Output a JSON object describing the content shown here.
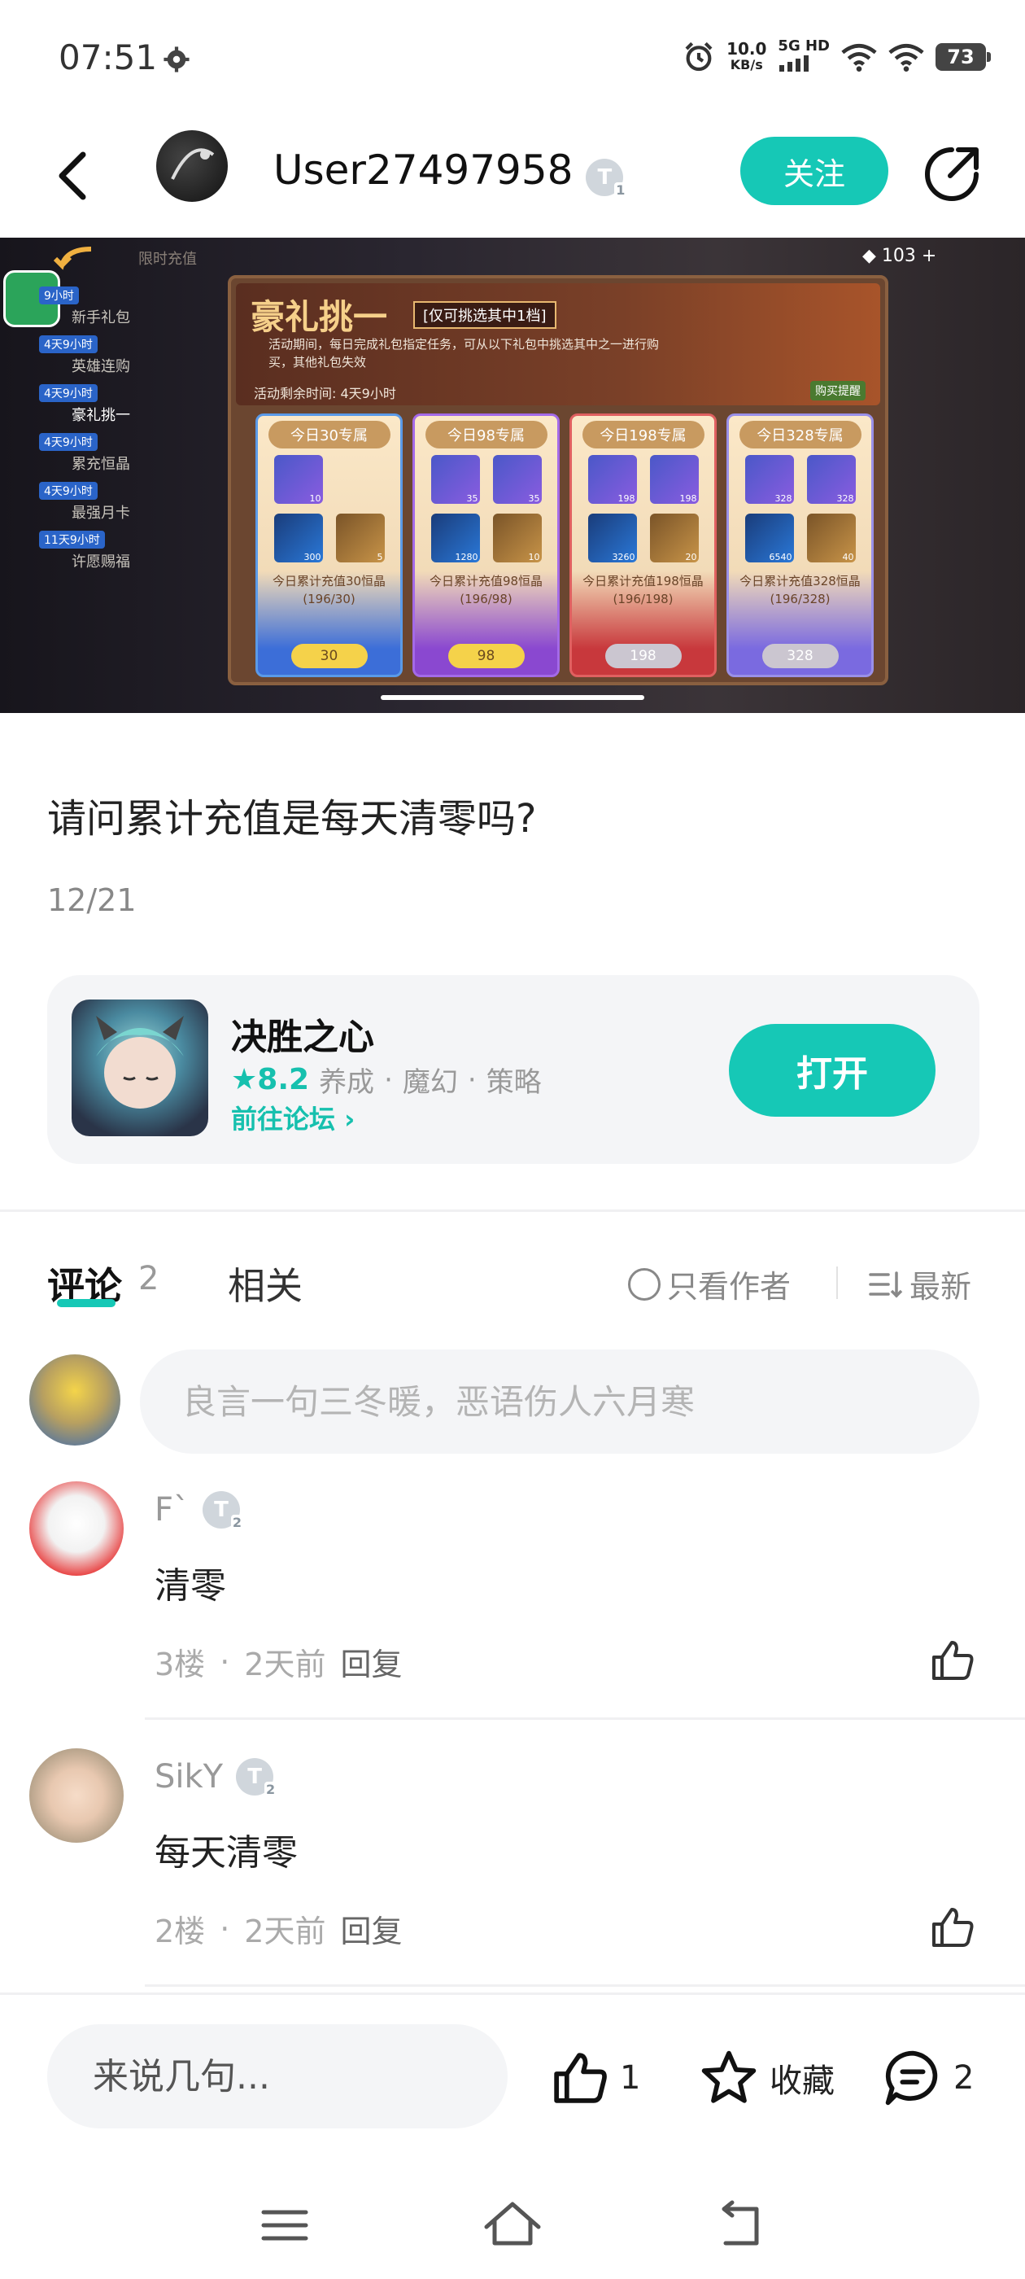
{
  "status_bar": {
    "time": "07:51",
    "speed_value": "10.0",
    "speed_unit": "KB/s",
    "network": "5G HD",
    "battery": "73"
  },
  "header": {
    "username": "User27497958",
    "level_badge": "T",
    "level_number": "1",
    "follow_label": "关注"
  },
  "banner": {
    "top_label": "限时充值",
    "gem_count": "103",
    "side_items": [
      {
        "tag": "9小时",
        "label": "新手礼包"
      },
      {
        "tag": "4天9小时",
        "label": "英雄连购"
      },
      {
        "tag": "4天9小时",
        "label": "豪礼挑一"
      },
      {
        "tag": "4天9小时",
        "label": "累充恒晶"
      },
      {
        "tag": "4天9小时",
        "label": "最强月卡"
      },
      {
        "tag": "11天9小时",
        "label": "许愿赐福"
      }
    ],
    "panel_title": "豪礼挑一",
    "panel_subtitle": "[仅可挑选其中1档]",
    "panel_desc": "活动期间，每日完成礼包指定任务，可从以下礼包中挑选其中之一进行购买，其他礼包失效",
    "panel_remaining": "活动剩余时间: 4天9小时",
    "panel_buy_hint": "购买提醒",
    "cards": [
      {
        "head": "今日30专属",
        "qty": [
          "10",
          "",
          "300",
          "5"
        ],
        "text1": "今日累计充值30恒晶",
        "text2": "(196/30)",
        "price": "30"
      },
      {
        "head": "今日98专属",
        "qty": [
          "35",
          "35",
          "1280",
          "10"
        ],
        "text1": "今日累计充值98恒晶",
        "text2": "(196/98)",
        "price": "98"
      },
      {
        "head": "今日198专属",
        "qty": [
          "198",
          "198",
          "3260",
          "20"
        ],
        "text1": "今日累计充值198恒晶",
        "text2": "(196/198)",
        "price": "198"
      },
      {
        "head": "今日328专属",
        "qty": [
          "328",
          "328",
          "6540",
          "40"
        ],
        "text1": "今日累计充值328恒晶",
        "text2": "(196/328)",
        "price": "328"
      }
    ]
  },
  "post": {
    "title": "请问累计充值是每天清零吗?",
    "date": "12/21"
  },
  "game": {
    "name": "决胜之心",
    "rating": "8.2",
    "tags": [
      "养成",
      "魔幻",
      "策略"
    ],
    "forum_link": "前往论坛",
    "open_label": "打开"
  },
  "tabs": {
    "comments_label": "评论",
    "comments_count": "2",
    "related_label": "相关",
    "only_author": "只看作者",
    "sort_label": "最新"
  },
  "comment_input": {
    "placeholder": "良言一句三冬暖，恶语伤人六月寒"
  },
  "comments": [
    {
      "name": "F`",
      "level": "T",
      "level_number": "2",
      "text": "清零",
      "floor": "3楼",
      "time": "2天前",
      "reply": "回复"
    },
    {
      "name": "SikY",
      "level": "T",
      "level_number": "2",
      "text": "每天清零",
      "floor": "2楼",
      "time": "2天前",
      "reply": "回复"
    }
  ],
  "bottom_bar": {
    "placeholder": "来说几句...",
    "like_count": "1",
    "favorite_label": "收藏",
    "comment_count": "2"
  },
  "colors": {
    "accent": "#16c8b6",
    "text_primary": "#111111",
    "text_secondary": "#888888"
  }
}
